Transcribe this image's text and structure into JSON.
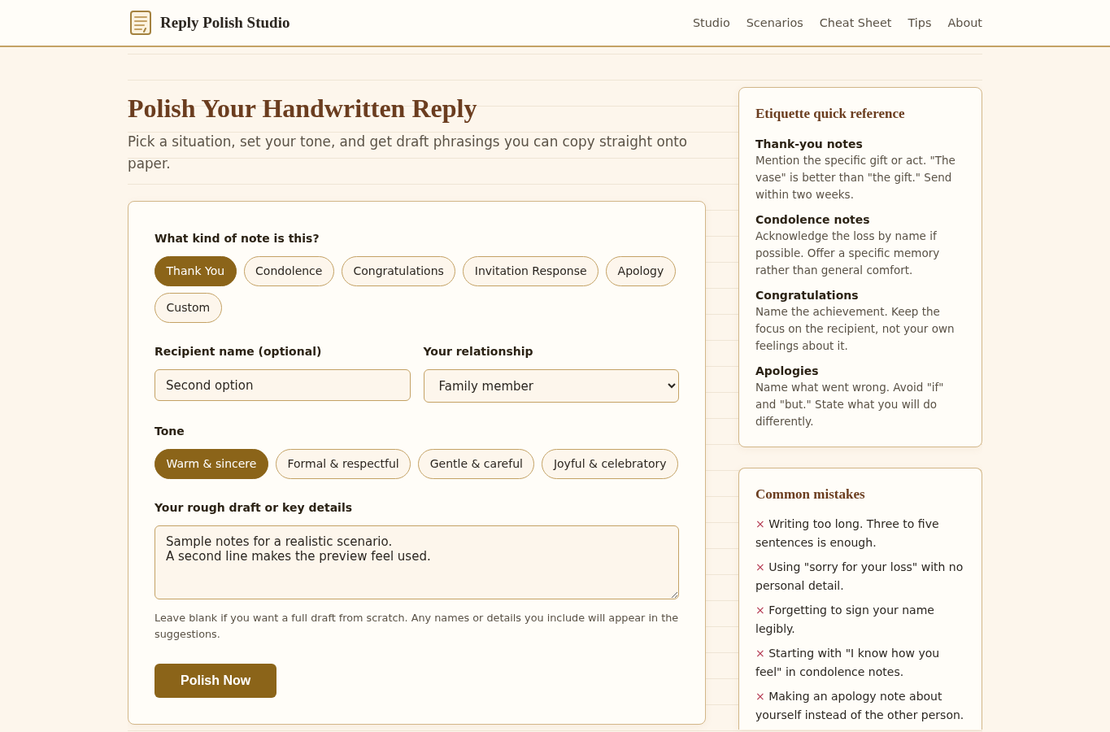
{
  "header": {
    "brand": "Reply Polish Studio",
    "nav": [
      "Studio",
      "Scenarios",
      "Cheat Sheet",
      "Tips",
      "About"
    ]
  },
  "intro": {
    "title": "Polish Your Handwritten Reply",
    "subtitle": "Pick a situation, set your tone, and get draft phrasings you can copy straight onto paper."
  },
  "form": {
    "note_type": {
      "label": "What kind of note is this?",
      "options": [
        {
          "label": "Thank You",
          "selected": true
        },
        {
          "label": "Condolence",
          "selected": false
        },
        {
          "label": "Congratulations",
          "selected": false
        },
        {
          "label": "Invitation Response",
          "selected": false
        },
        {
          "label": "Apology",
          "selected": false
        },
        {
          "label": "Custom",
          "selected": false
        }
      ]
    },
    "recipient": {
      "label": "Recipient name (optional)",
      "value": "Second option"
    },
    "relationship": {
      "label": "Your relationship",
      "value": "Family member"
    },
    "tone": {
      "label": "Tone",
      "options": [
        {
          "label": "Warm & sincere",
          "selected": true
        },
        {
          "label": "Formal & respectful",
          "selected": false
        },
        {
          "label": "Gentle & careful",
          "selected": false
        },
        {
          "label": "Joyful & celebratory",
          "selected": false
        }
      ]
    },
    "draft": {
      "label": "Your rough draft or key details",
      "value": "Sample notes for a realistic scenario.\nA second line makes the preview feel used."
    },
    "hint": "Leave blank if you want a full draft from scratch. Any names or details you include will appear in the suggestions.",
    "submit": "Polish Now"
  },
  "sidebar": {
    "reference": {
      "title": "Etiquette quick reference",
      "items": [
        {
          "heading": "Thank-you notes",
          "text": "Mention the specific gift or act. \"The vase\" is better than \"the gift.\" Send within two weeks."
        },
        {
          "heading": "Condolence notes",
          "text": "Acknowledge the loss by name if possible. Offer a specific memory rather than general comfort."
        },
        {
          "heading": "Congratulations",
          "text": "Name the achievement. Keep the focus on the recipient, not your own feelings about it."
        },
        {
          "heading": "Apologies",
          "text": "Name what went wrong. Avoid \"if\" and \"but.\" State what you will do differently."
        }
      ]
    },
    "mistakes": {
      "title": "Common mistakes",
      "items": [
        {
          "marker": "×",
          "text": "Writing too long. Three to five sentences is enough."
        },
        {
          "marker": "×",
          "text": "Using \"sorry for your loss\" with no personal detail."
        },
        {
          "marker": "×",
          "text": "Forgetting to sign your name legibly."
        },
        {
          "marker": "×",
          "text": "Starting with \"I know how you feel\" in condolence notes."
        },
        {
          "marker": "×",
          "text": "Making an apology note about yourself instead of the other person."
        }
      ]
    }
  }
}
